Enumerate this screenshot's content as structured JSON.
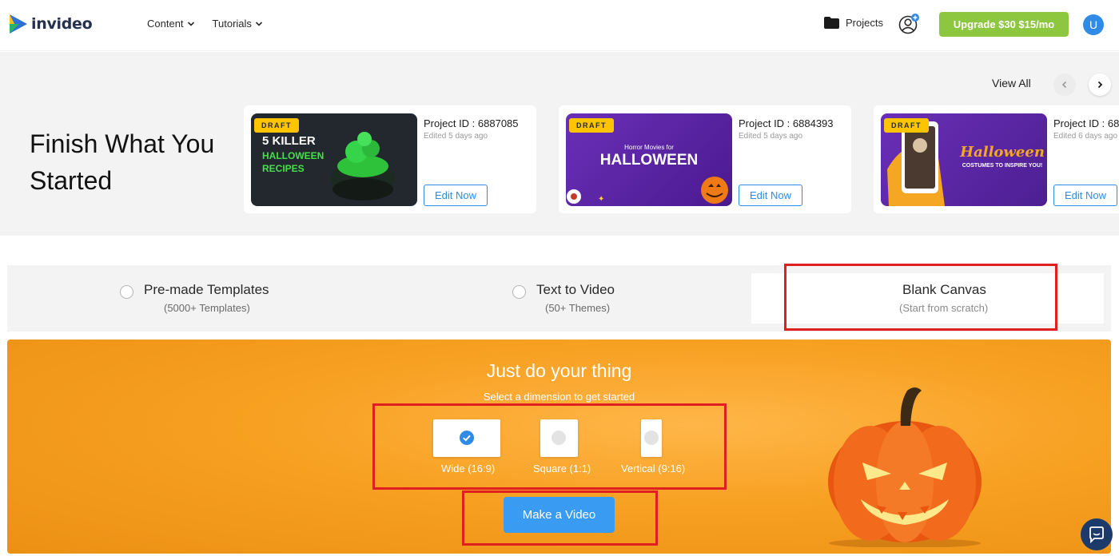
{
  "header": {
    "logo_text": "invideo",
    "nav": [
      {
        "label": "Content"
      },
      {
        "label": "Tutorials"
      }
    ],
    "projects_label": "Projects",
    "upgrade_label": "Upgrade $30 $15/mo",
    "avatar_initial": "U"
  },
  "finish": {
    "title": "Finish What You Started",
    "view_all": "View All",
    "cards": [
      {
        "draft": "DRAFT",
        "project_id": "Project ID : 6887085",
        "edited": "Edited 5 days ago",
        "edit_label": "Edit Now",
        "thumb_line1": "5 KILLER",
        "thumb_line2": "HALLOWEEN",
        "thumb_line3": "RECIPES"
      },
      {
        "draft": "DRAFT",
        "project_id": "Project ID : 6884393",
        "edited": "Edited 5 days ago",
        "edit_label": "Edit Now",
        "thumb_line1": "Horror Movies for",
        "thumb_line2": "HALLOWEEN"
      },
      {
        "draft": "DRAFT",
        "project_id": "Project ID : 68",
        "edited": "Edited 6 days ago",
        "edit_label": "Edit Now",
        "thumb_line1": "Halloween",
        "thumb_line2": "COSTUMES TO INSPIRE YOU!"
      }
    ]
  },
  "options": [
    {
      "title": "Pre-made Templates",
      "subtitle": "(5000+ Templates)",
      "selected": false
    },
    {
      "title": "Text to Video",
      "subtitle": "(50+ Themes)",
      "selected": false
    },
    {
      "title": "Blank Canvas",
      "subtitle": "(Start from scratch)",
      "selected": true
    }
  ],
  "banner": {
    "title": "Just do your thing",
    "subtitle": "Select a dimension to get started",
    "dimensions": [
      {
        "label": "Wide (16:9)",
        "selected": true
      },
      {
        "label": "Square (1:1)",
        "selected": false
      },
      {
        "label": "Vertical (9:16)",
        "selected": false
      }
    ],
    "make_label": "Make a Video"
  },
  "colors": {
    "accent": "#2f8be6",
    "upgrade": "#8dc63f",
    "draft": "#ffc400",
    "banner": "#f7a021",
    "highlight": "#e02020"
  },
  "icons": [
    "invideo-logo-icon",
    "chevron-down-icon",
    "folder-icon",
    "user-add-icon",
    "chevron-left-icon",
    "chevron-right-icon",
    "check-icon",
    "chat-icon",
    "pumpkin-icon"
  ]
}
